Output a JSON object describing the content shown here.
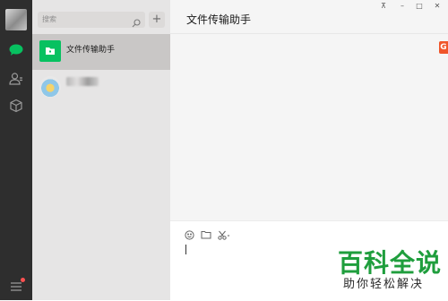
{
  "colors": {
    "accent": "#07c160",
    "nav_bg": "#2e2e2e",
    "list_bg": "#e6e5e5",
    "chat_bg": "#f5f5f5",
    "badge": "#f0552a",
    "watermark": "#1f9e3d"
  },
  "sidebar": {
    "icons": [
      "chat-icon",
      "contacts-icon",
      "favorites-cube-icon",
      "menu-icon"
    ],
    "has_menu_notification": true
  },
  "search": {
    "placeholder": "搜索"
  },
  "add_button": {
    "label": "+"
  },
  "conversations": [
    {
      "name": "文件传输助手",
      "avatar_icon": "folder-icon",
      "active": true
    },
    {
      "name": "",
      "avatar_icon": "contact-avatar",
      "active": false
    }
  ],
  "window_controls": {
    "pin": "⊼",
    "minimize": "–",
    "maximize": "□",
    "close": "✕"
  },
  "chat": {
    "title": "文件传输助手",
    "side_badge": "G"
  },
  "toolbar": [
    "emoji-icon",
    "folder-icon",
    "scissors-icon"
  ],
  "watermark": {
    "title": "百科全说",
    "subtitle": "助你轻松解决"
  }
}
